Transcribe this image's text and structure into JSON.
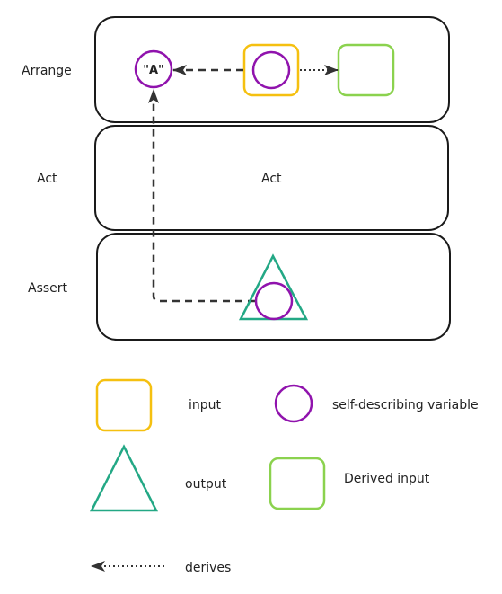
{
  "rows": {
    "arrange": "Arrange",
    "act": "Act",
    "act_box": "Act",
    "assert": "Assert"
  },
  "arrange_value": "\"A\"",
  "legend": {
    "input": "input",
    "variable": "self-describing variable",
    "output": "output",
    "derived": "Derived input",
    "derives": "derives"
  },
  "colors": {
    "input": "#f5c010",
    "variable": "#9013ad",
    "output": "#23a885",
    "derived": "#8bd24e",
    "arrow": "#333333"
  }
}
